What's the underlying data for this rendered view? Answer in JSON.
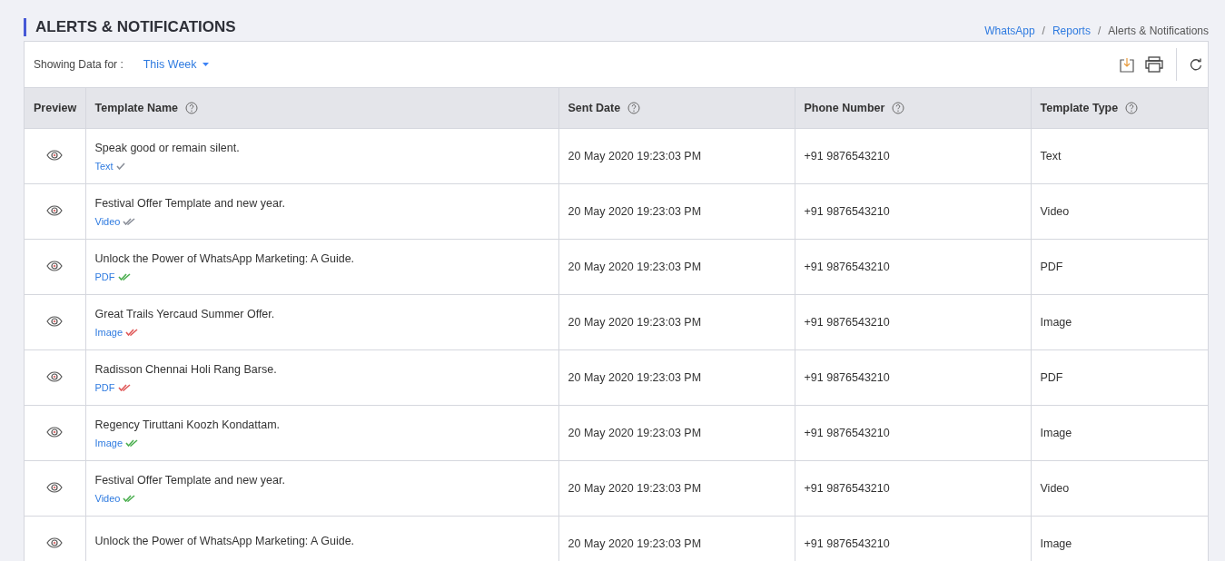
{
  "page_title": "ALERTS & NOTIFICATIONS",
  "breadcrumb": [
    {
      "kind": "link",
      "label": "WhatsApp"
    },
    {
      "kind": "separator",
      "label": "/"
    },
    {
      "kind": "link",
      "label": "Reports"
    },
    {
      "kind": "separator",
      "label": "/"
    },
    {
      "kind": "current",
      "label": "Alerts & Notifications"
    }
  ],
  "filter": {
    "label": "Showing Data for :",
    "value": "This Week"
  },
  "table": {
    "columns": [
      {
        "label": "Preview",
        "help": false
      },
      {
        "label": "Template Name",
        "help": true
      },
      {
        "label": "Sent Date",
        "help": true
      },
      {
        "label": "Phone Number",
        "help": true
      },
      {
        "label": "Template Type",
        "help": true
      }
    ],
    "rows": [
      {
        "name": "Speak good or remain silent.",
        "tag": "Text",
        "tick": {
          "kind": "single",
          "color": "#8a8f99"
        },
        "sent_date": "20 May 2020 19:23:03 PM",
        "phone": "+91 9876543210",
        "type": "Text"
      },
      {
        "name": "Festival Offer Template and new year.",
        "tag": "Video",
        "tick": {
          "kind": "double",
          "color": "#8a8f99"
        },
        "sent_date": "20 May 2020 19:23:03 PM",
        "phone": "+91 9876543210",
        "type": "Video"
      },
      {
        "name": "Unlock the Power of WhatsApp Marketing: A Guide.",
        "tag": "PDF",
        "tick": {
          "kind": "double",
          "color": "#4caf50"
        },
        "sent_date": "20 May 2020 19:23:03 PM",
        "phone": "+91 9876543210",
        "type": "PDF"
      },
      {
        "name": "Great Trails Yercaud Summer Offer.",
        "tag": "Image",
        "tick": {
          "kind": "double",
          "color": "#e05a5a"
        },
        "sent_date": "20 May 2020 19:23:03 PM",
        "phone": "+91 9876543210",
        "type": "Image"
      },
      {
        "name": "Radisson Chennai Holi Rang Barse.",
        "tag": "PDF",
        "tick": {
          "kind": "double",
          "color": "#e05a5a"
        },
        "sent_date": "20 May 2020 19:23:03 PM",
        "phone": "+91 9876543210",
        "type": "PDF"
      },
      {
        "name": "Regency Tiruttani Koozh Kondattam.",
        "tag": "Image",
        "tick": {
          "kind": "double",
          "color": "#4caf50"
        },
        "sent_date": "20 May 2020 19:23:03 PM",
        "phone": "+91 9876543210",
        "type": "Image"
      },
      {
        "name": "Festival Offer Template and new year.",
        "tag": "Video",
        "tick": {
          "kind": "double",
          "color": "#4caf50"
        },
        "sent_date": "20 May 2020 19:23:03 PM",
        "phone": "+91 9876543210",
        "type": "Video"
      },
      {
        "name": "Unlock the Power of WhatsApp Marketing: A Guide.",
        "sent_date": "20 May 2020 19:23:03 PM",
        "phone": "+91 9876543210",
        "type": "Image"
      }
    ]
  }
}
